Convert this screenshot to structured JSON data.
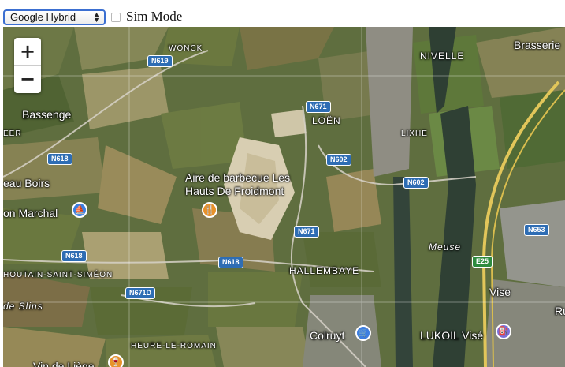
{
  "toolbar": {
    "map_type_selected": "Google Hybrid",
    "sim_mode_label": "Sim Mode",
    "sim_mode_checked": false
  },
  "zoom": {
    "in_label": "+",
    "out_label": "−"
  },
  "places": {
    "wonck": "WONCK",
    "nivelle": "NIVELLE",
    "brasserie": "Brasserie",
    "bassenge": "Bassenge",
    "eer": "EER",
    "loen": "LOËN",
    "lixhe": "LIXHE",
    "eau_boirs": "eau Boirs",
    "aire_line1": "Aire de barbecue Les",
    "aire_line2": "Hauts De Froidmont",
    "on_marchal": "on Marchal",
    "meuse": "Meuse",
    "houtain": "HOUTAIN-SAINT-SIMÉON",
    "hallembaye": "HALLEMBAYE",
    "de_slins": "de Slins",
    "vise": "Vise",
    "ru": "Ru",
    "colruyt": "Colruyt",
    "lukoil": "LUKOIL Visé",
    "heure": "HEURE-LE-ROMAIN",
    "vin_de_liege": "Vin de Liège"
  },
  "roads": {
    "n619": "N619",
    "n671_a": "N671",
    "n618_a": "N618",
    "n602_a": "N602",
    "n602_b": "N602",
    "n671_b": "N671",
    "n618_b": "N618",
    "n618_c": "N618",
    "n671d": "N671D",
    "n653": "N653",
    "e25": "E25"
  },
  "colors": {
    "road_shield": "#2e6db4",
    "highway_shield": "#2e8b3e",
    "select_border": "#3b6fd1",
    "poi_blue": "#3d7ee0",
    "poi_orange": "#e8922a"
  },
  "icons": {
    "zoom_in": "plus-icon",
    "zoom_out": "minus-icon",
    "poi_marchal": "boat-icon",
    "poi_aire": "restaurant-icon",
    "poi_colruyt": "shopping-cart-icon",
    "poi_lukoil": "fuel-icon",
    "poi_vin": "wine-icon"
  }
}
